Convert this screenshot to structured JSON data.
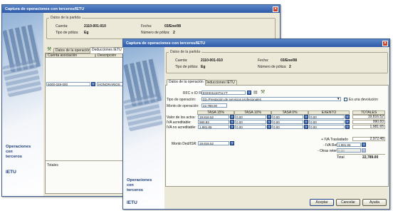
{
  "back_window": {
    "title": "Captura de operaciones con terceros/IETU",
    "brand": {
      "line1": "Operaciones",
      "line2": "con",
      "line3": "terceros",
      "ietu": "IETU"
    },
    "partida": {
      "group_label": "Datos de la partida",
      "cuenta_label": "Cuenta:",
      "cuenta_value": "2110-001-010",
      "fecha_label": "Fecha:",
      "fecha_value": "03/Ene/08",
      "tipo_label": "Tipo de póliza:",
      "tipo_value": "Eg",
      "numero_label": "Número de póliza:",
      "numero_value": "2"
    },
    "tabs": [
      "Datos de la operación",
      "Deducciones IETU"
    ],
    "columns": [
      "Cuenta asociación",
      "Descripción"
    ],
    "row": {
      "cuenta": "6000-028-000",
      "descripcion": "HONORARIOS"
    },
    "totales_label": "Totales"
  },
  "front_window": {
    "title": "Captura de operaciones con terceros/IETU",
    "brand": {
      "line1": "Operaciones",
      "line2": "con",
      "line3": "terceros",
      "ietu": "IETU"
    },
    "partida": {
      "group_label": "Datos de la partida",
      "cuenta_label": "Cuenta:",
      "cuenta_value": "2110-001-010",
      "fecha_label": "Fecha:",
      "fecha_value": "03/Ene/08",
      "tipo_label": "Tipo de póliza:",
      "tipo_value": "Eg",
      "numero_label": "Número de póliza:",
      "numero_value": "2"
    },
    "tabs": [
      "Datos de la operación",
      "Deducciones IETU"
    ],
    "form": {
      "rfc_label": "RFC o ID Fiscal:",
      "rfc_value": "ESHD111071LYT",
      "tipo_label": "Tipo de operación:",
      "tipo_value": "03=Prestación de servicios profesionales",
      "devolucion_label": "Es una devolución",
      "monto_label": "Monto de operación:",
      "monto_value": "22,789.00"
    },
    "grid": {
      "headers": [
        "TASA 15%",
        "TASA 10%",
        "TASA 0%",
        "EXENTO",
        "TOTALES"
      ],
      "rows": [
        {
          "label": "Valor de los actos:",
          "cells": [
            "19,816.52",
            "0.00",
            "0.00",
            "0.00"
          ],
          "total": "19,816.52"
        },
        {
          "label": "IVA acreditable:",
          "cells": [
            "990.83",
            "0.00",
            "0.00",
            "0.00"
          ],
          "total": "990.83"
        },
        {
          "label": "IVA no acreditable:",
          "cells": [
            "1,981.65",
            "0.00",
            "0.00",
            "0.00"
          ],
          "total": "1,981.65"
        }
      ],
      "isr_label": "Monto Ded/ISR:",
      "isr_value": "19,816.52",
      "trasladado_label": "+ IVA Trasladado",
      "trasladado_value": "2,972.48",
      "retenido_label": "- IVA Retenido",
      "retenido_value": "1,981.65",
      "otras_label": "- Otras retenciones",
      "otras_value": "0.00",
      "total_label": "Total",
      "total_value": "22,789.00"
    },
    "buttons": {
      "accept": "Aceptar",
      "cancel": "Cancelar",
      "help": "Ayuda"
    }
  }
}
